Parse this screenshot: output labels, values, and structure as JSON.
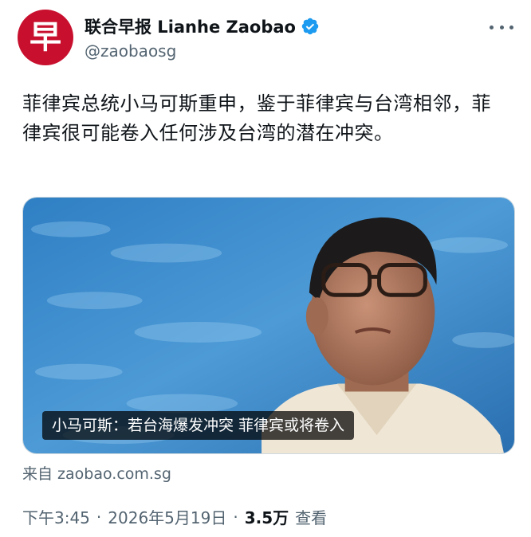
{
  "account": {
    "avatar_glyph": "早",
    "display_name": "联合早报 Lianhe Zaobao",
    "handle": "@zaobaosg",
    "verified_color": "#1d9bf0",
    "brand_color": "#c8102e"
  },
  "tweet": {
    "text": "菲律宾总统小马可斯重申，鉴于菲律宾与台湾相邻，菲律宾很可能卷入任何涉及台湾的潜在冲突。",
    "media_caption": "小马可斯：若台海爆发冲突 菲律宾或将卷入",
    "source": "来自 zaobao.com.sg"
  },
  "meta": {
    "time": "下午3:45",
    "date": "2026年5月19日",
    "views_count": "3.5万",
    "views_label": "查看",
    "separator": "·"
  },
  "icons": {
    "more": "more-horizontal-icon",
    "verified": "verified-badge-icon"
  }
}
